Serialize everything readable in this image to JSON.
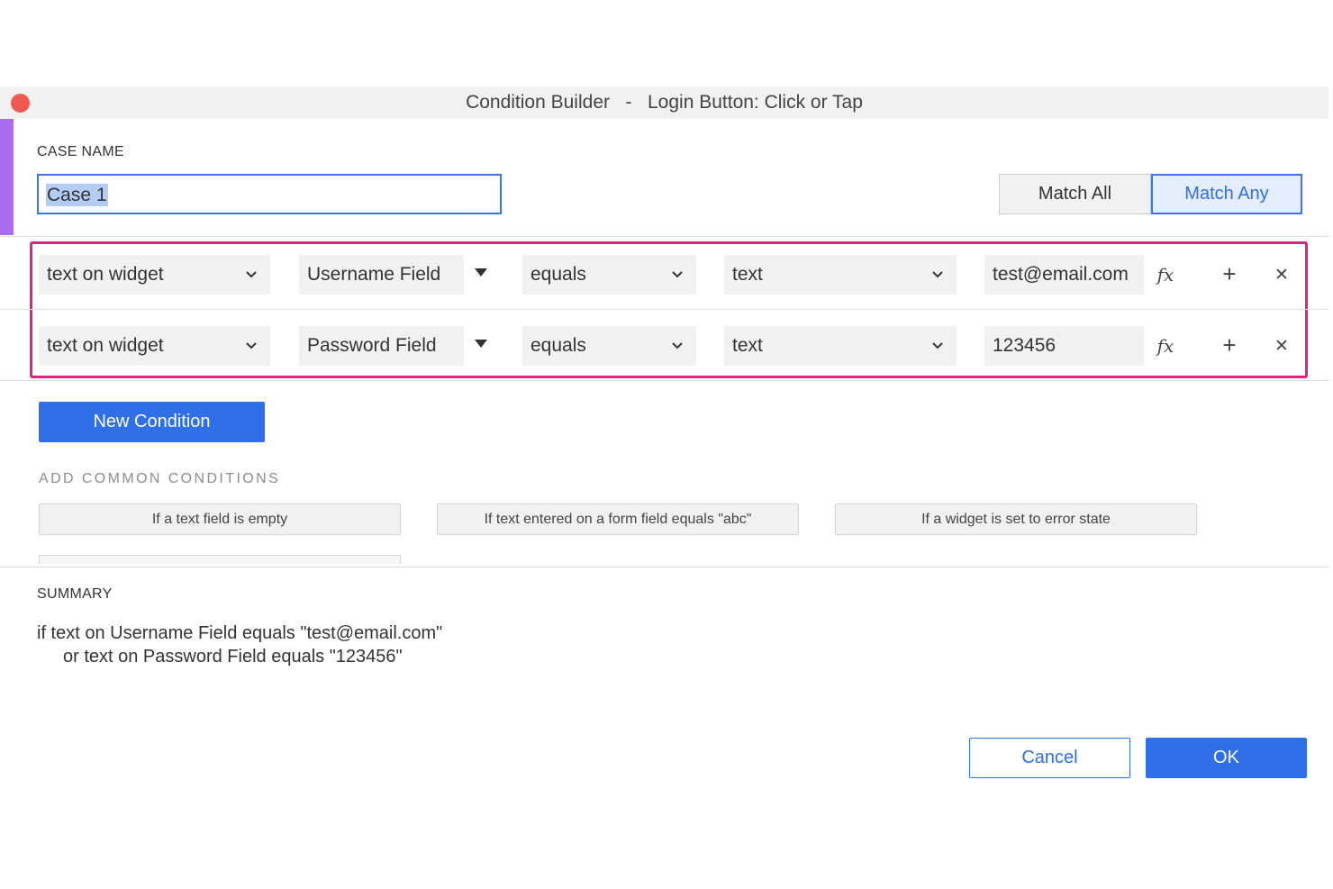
{
  "window": {
    "title": "Condition Builder   -   Login Button: Click or Tap"
  },
  "case": {
    "label": "CASE NAME",
    "value": "Case 1"
  },
  "match": {
    "all_label": "Match All",
    "any_label": "Match Any",
    "selected": "Match Any"
  },
  "conditions": [
    {
      "source": "text on widget",
      "target": "Username Field",
      "operator": "equals",
      "value_type": "text",
      "value": "test@email.com"
    },
    {
      "source": "text on widget",
      "target": "Password Field",
      "operator": "equals",
      "value_type": "text",
      "value": "123456"
    }
  ],
  "icons": {
    "function": "fx-icon",
    "add": "plus-icon",
    "remove": "close-icon",
    "fx_glyph": "𝑓x",
    "plus_glyph": "+",
    "x_glyph": "✕"
  },
  "actions": {
    "new_condition": "New Condition",
    "cancel": "Cancel",
    "ok": "OK"
  },
  "common": {
    "label": "ADD COMMON CONDITIONS",
    "items": [
      "If a text field is empty",
      "If text entered on a form field equals \"abc\"",
      "If a widget is set to error state"
    ]
  },
  "summary": {
    "label": "SUMMARY",
    "line1": "if text on Username Field equals \"test@email.com\"",
    "line2": "or text on Password Field equals \"123456\""
  },
  "colors": {
    "accent": "#2f6fe8",
    "highlight": "#e2237d",
    "side_accent": "#a86cf0",
    "close_dot": "#ee5a52"
  }
}
